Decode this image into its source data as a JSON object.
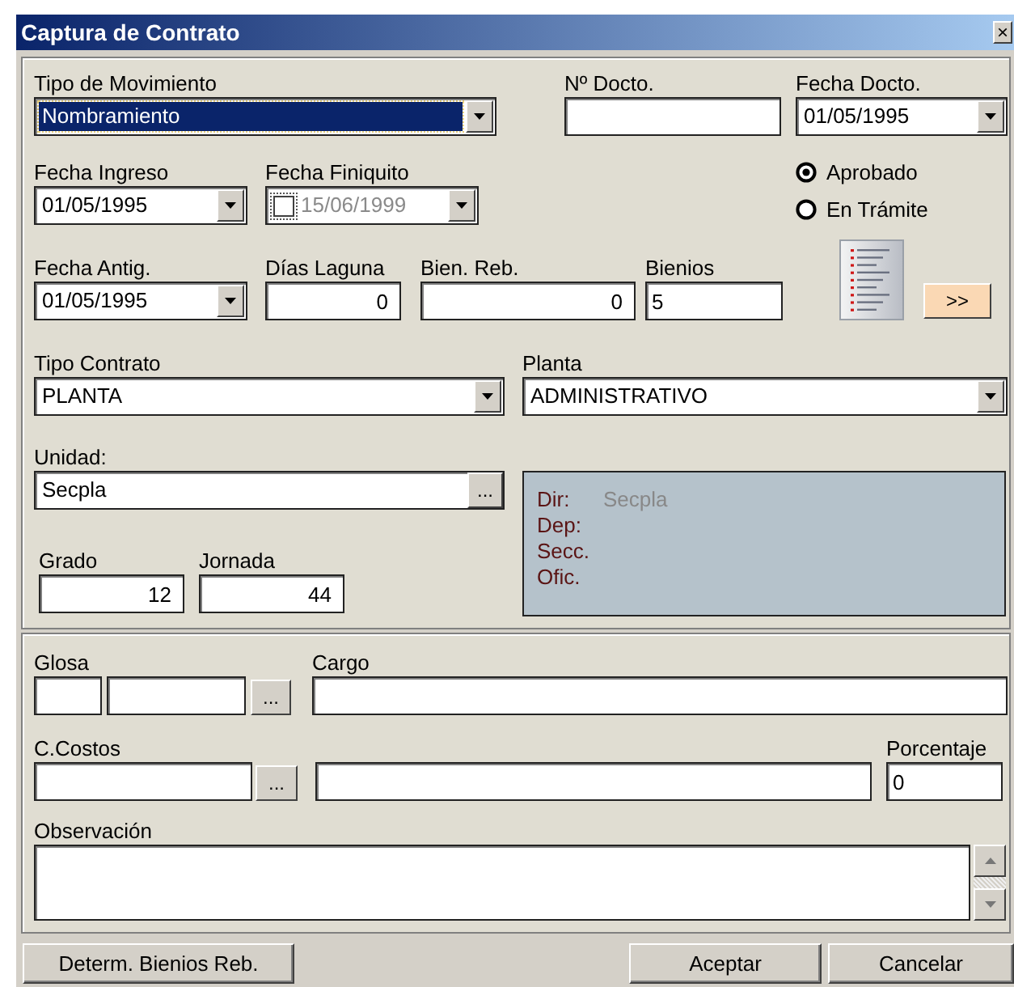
{
  "window": {
    "title": "Captura de Contrato",
    "close": "×"
  },
  "top_rows": [
    [
      {
        "kind": "combo",
        "label": "Tipo de Movimiento",
        "value": "Nombramiento",
        "selected": true
      },
      {
        "kind": "text",
        "label": "Nº Docto."
      },
      {
        "kind": "combo",
        "label": "Fecha Docto.",
        "value": "01/05/1995",
        "selected": false
      }
    ],
    [
      {
        "kind": "combo",
        "label": "Fecha Ingreso",
        "value": "01/05/1995",
        "selected": false
      },
      {
        "kind": "datecheck",
        "label": "Fecha Finiquito",
        "value": "15/06/1999",
        "checked": false
      }
    ],
    [
      {
        "kind": "combo",
        "label": "Fecha Antig.",
        "value": "01/05/1995",
        "selected": false
      },
      {
        "kind": "number",
        "label": "Días Laguna",
        "value": "0"
      },
      {
        "kind": "number",
        "label": "Bien. Reb.",
        "value": "0"
      },
      {
        "kind": "text",
        "label": "Bienios",
        "value": "5"
      }
    ],
    [
      {
        "kind": "combo",
        "label": "Tipo Contrato",
        "value": "PLANTA",
        "selected": false
      },
      {
        "kind": "combo",
        "label": "Planta",
        "value": "ADMINISTRATIVO",
        "selected": false
      }
    ]
  ],
  "status_options": [
    {
      "label": "Aprobado",
      "selected": true
    },
    {
      "label": "En Trámite",
      "selected": false
    }
  ],
  "next_button": ">>",
  "unidad": {
    "label": "Unidad:",
    "value": "Secpla",
    "browse": "..."
  },
  "grado": {
    "label": "Grado",
    "value": "12"
  },
  "jornada": {
    "label": "Jornada",
    "value": "44"
  },
  "unit_info": [
    {
      "label": "Dir:",
      "value": "Secpla"
    },
    {
      "label": "Dep:"
    },
    {
      "label": "Secc."
    },
    {
      "label": "Ofic."
    }
  ],
  "glosa": {
    "label": "Glosa",
    "browse": "..."
  },
  "cargo": {
    "label": "Cargo"
  },
  "costos": {
    "label": "C.Costos",
    "browse": "..."
  },
  "porcentaje": {
    "label": "Porcentaje",
    "value": "0"
  },
  "observacion": {
    "label": "Observación"
  },
  "buttons": [
    {
      "label": "Determ. Bienios Reb."
    },
    {
      "label": "Aceptar"
    },
    {
      "label": "Cancelar"
    }
  ]
}
